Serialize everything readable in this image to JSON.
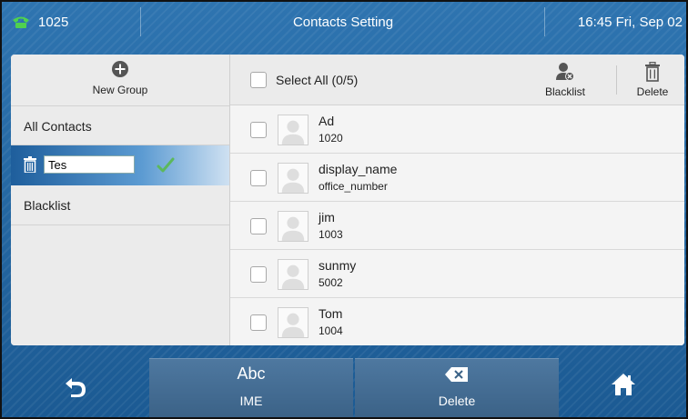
{
  "titlebar": {
    "line": "1025",
    "title": "Contacts Setting",
    "datetime": "16:45 Fri, Sep 02"
  },
  "left_panel": {
    "new_group_label": "New Group",
    "items": [
      {
        "label": "All Contacts"
      },
      {
        "edit_value": "Tes",
        "state": "editing"
      },
      {
        "label": "Blacklist"
      }
    ]
  },
  "right_panel": {
    "select_all_label": "Select All (0/5)",
    "blacklist_label": "Blacklist",
    "delete_label": "Delete",
    "contacts": [
      {
        "name": "Ad",
        "number": "1020"
      },
      {
        "name": "display_name",
        "number": "office_number"
      },
      {
        "name": "jim",
        "number": "1003"
      },
      {
        "name": "sunmy",
        "number": "5002"
      },
      {
        "name": "Tom",
        "number": "1004"
      }
    ]
  },
  "softkeys": {
    "back": "back-arrow-icon",
    "ime_top": "Abc",
    "ime_label": "IME",
    "delete_label": "Delete",
    "home": "home-icon"
  },
  "colors": {
    "accent": "#2e74b0",
    "selected_row": "#1e5e9c",
    "check_green": "#4caf50"
  }
}
